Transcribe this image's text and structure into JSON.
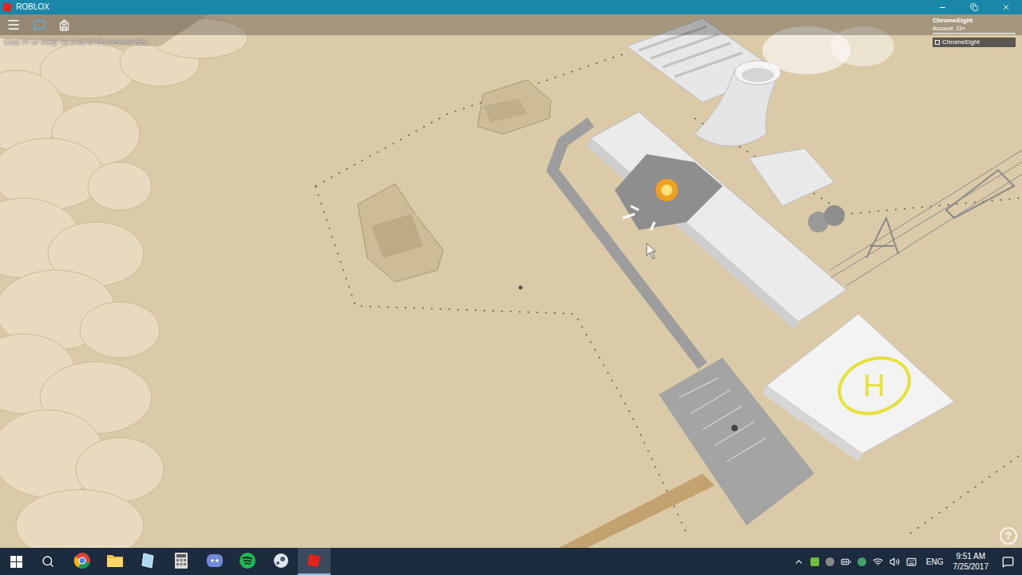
{
  "window": {
    "title": "ROBLOX"
  },
  "chat_hint": "Chat '/?' or '/help' for a list of chat commands.",
  "account": {
    "name": "ChromeEight",
    "age": "Account: 13+"
  },
  "leaderboard": [
    {
      "name": "ChromeEight"
    }
  ],
  "help_button": "?",
  "helipad_mark": "H",
  "taskbar": {
    "apps": [
      {
        "kind": "chrome",
        "selected": false
      },
      {
        "kind": "explorer",
        "selected": false
      },
      {
        "kind": "crystal",
        "selected": false
      },
      {
        "kind": "calculator",
        "selected": false
      },
      {
        "kind": "discord",
        "selected": false
      },
      {
        "kind": "spotify",
        "selected": false
      },
      {
        "kind": "steam",
        "selected": false
      },
      {
        "kind": "roblox",
        "selected": true
      }
    ],
    "language": "ENG",
    "time": "9:51 AM",
    "date": "7/25/2017"
  }
}
